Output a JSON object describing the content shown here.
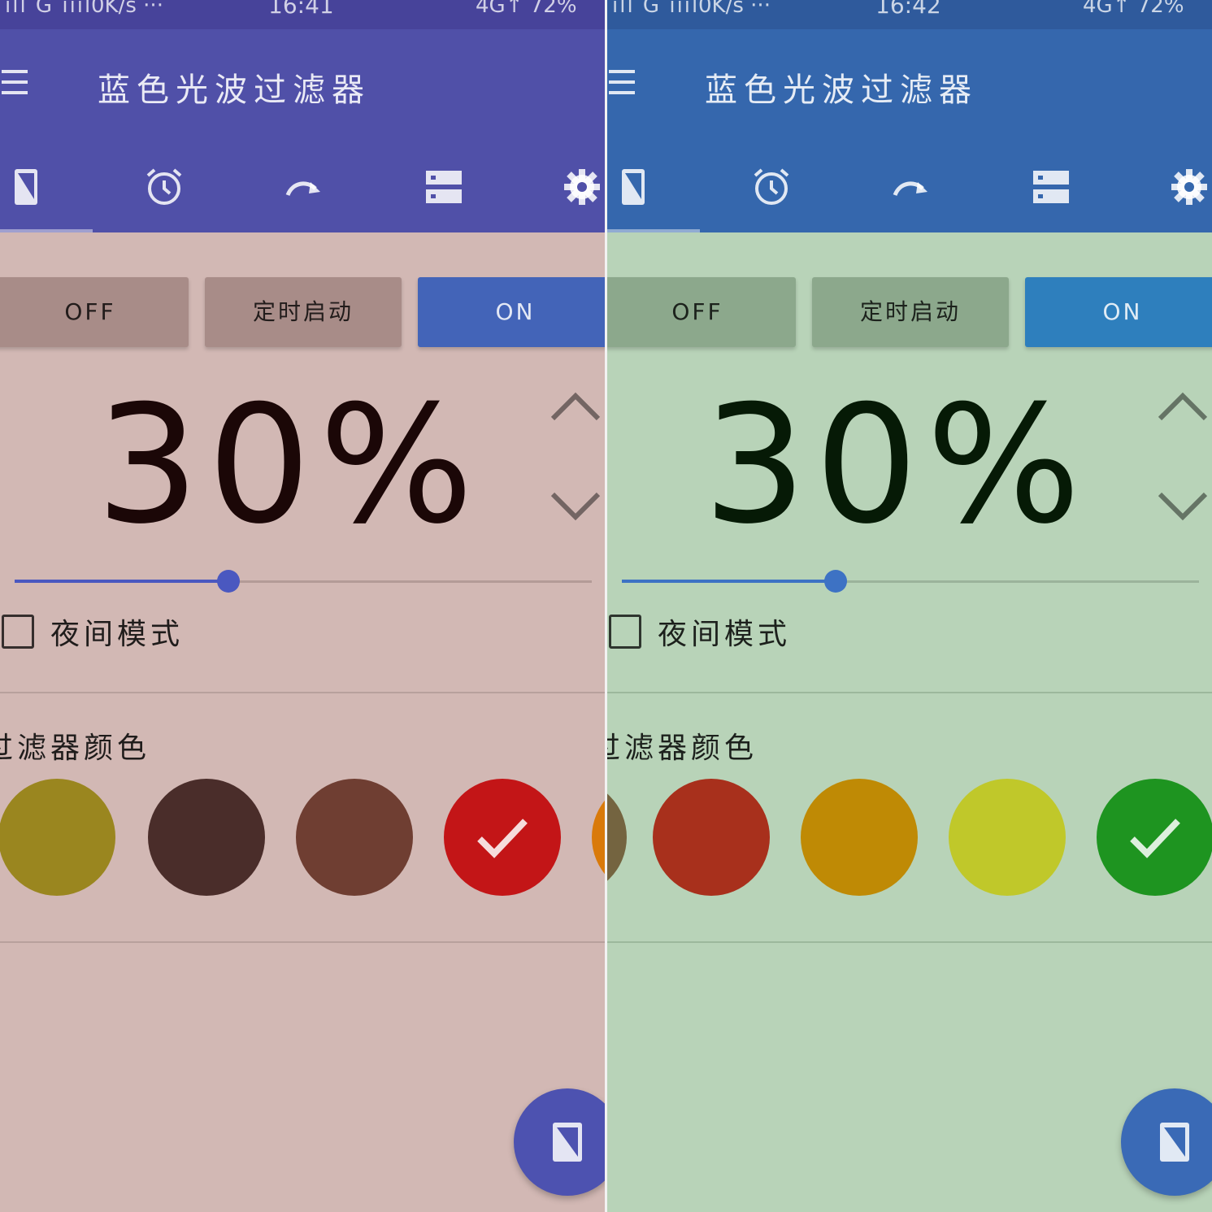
{
  "app_title": "蓝色光波过滤器",
  "buttons": {
    "off": "OFF",
    "timer": "定时启动",
    "on": "ON"
  },
  "percent": "30%",
  "intensity": 0.37,
  "night_mode_label": "夜间模式",
  "night_mode_checked": false,
  "filter_color_title": "过滤器颜色",
  "tabs": [
    "screen-filter-icon",
    "alarm-clock-icon",
    "redo-arrow-icon",
    "storage-icon",
    "gear-icon"
  ],
  "panels": [
    {
      "status": {
        "signal": "ıll G ıııl",
        "speed": "0K/s ···",
        "time": "16:41",
        "network": "4G↑ 72%"
      },
      "colors": {
        "appbar": "#5050a8",
        "status": "#47439a",
        "background": "#d2b8b4",
        "btn_gray": "#a88c88",
        "btn_on": "#4364b8",
        "accent": "#4a58c0",
        "digits": "#1b0707",
        "divider": "#b8a09c",
        "track": "#b39b97",
        "fab": "#4d52b0"
      },
      "swatches": [
        {
          "color": "#9a861f",
          "selected": false
        },
        {
          "color": "#4a2d2a",
          "selected": false
        },
        {
          "color": "#6f3e32",
          "selected": false
        },
        {
          "color": "#c31517",
          "selected": true
        },
        {
          "color": "#d97a0a",
          "selected": false
        }
      ]
    },
    {
      "status": {
        "signal": "ıll G ıııl",
        "speed": "0K/s ···",
        "time": "16:42",
        "network": "4G↑ 72%"
      },
      "colors": {
        "appbar": "#3567ad",
        "status": "#2f5a9c",
        "background": "#b8d3b8",
        "btn_gray": "#8ca88c",
        "btn_on": "#2e7fbd",
        "accent": "#3d72c4",
        "digits": "#061a06",
        "divider": "#9cb89c",
        "track": "#9bb39b",
        "fab": "#3a6ab6"
      },
      "swatches": [
        {
          "color": "#746440",
          "selected": false
        },
        {
          "color": "#a8301c",
          "selected": false
        },
        {
          "color": "#bf8a05",
          "selected": false
        },
        {
          "color": "#c0c82a",
          "selected": false
        },
        {
          "color": "#1e9420",
          "selected": true
        }
      ]
    }
  ]
}
